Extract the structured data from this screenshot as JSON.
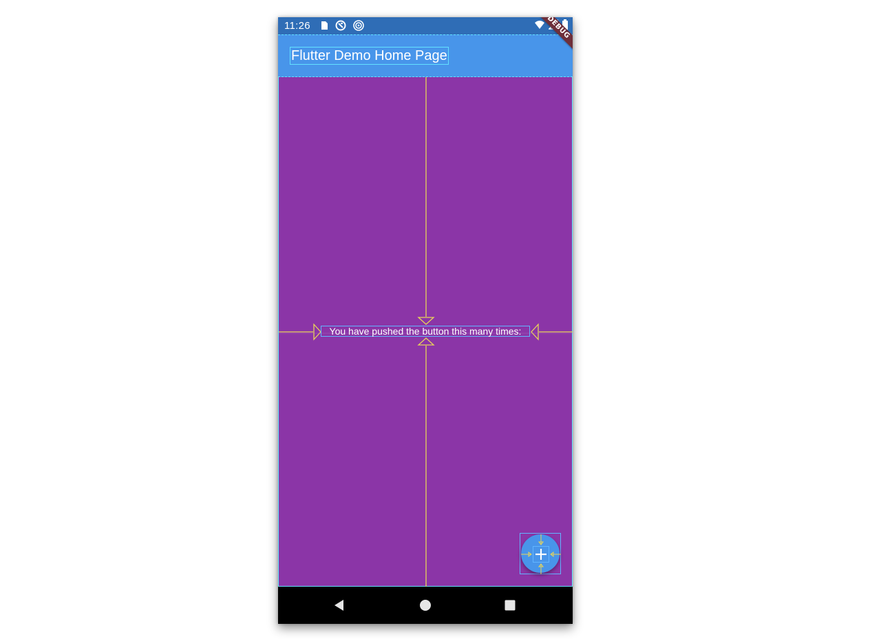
{
  "status_bar": {
    "time": "11:26",
    "left_icons": [
      "sd-card-icon",
      "sync-icon",
      "target-icon"
    ],
    "right_icons": [
      "wifi-icon",
      "signal-icon",
      "battery-icon"
    ]
  },
  "app_bar": {
    "title": "Flutter Demo Home Page"
  },
  "main": {
    "counter_label": "You have pushed the button this many times:"
  },
  "fab": {
    "icon": "plus-icon"
  },
  "debug_banner": {
    "label": "DEBUG"
  },
  "nav_bar": {
    "icons": [
      "back-icon",
      "home-icon",
      "recents-icon"
    ]
  },
  "colors": {
    "status_bar": "#2f6db6",
    "app_bar": "#4895ea",
    "body_background": "#8b35a7",
    "debug_guide": "#62e1ff",
    "layout_guide": "#e8d458",
    "fab": "#4895ea",
    "debug_banner": "#6e2f3a"
  }
}
